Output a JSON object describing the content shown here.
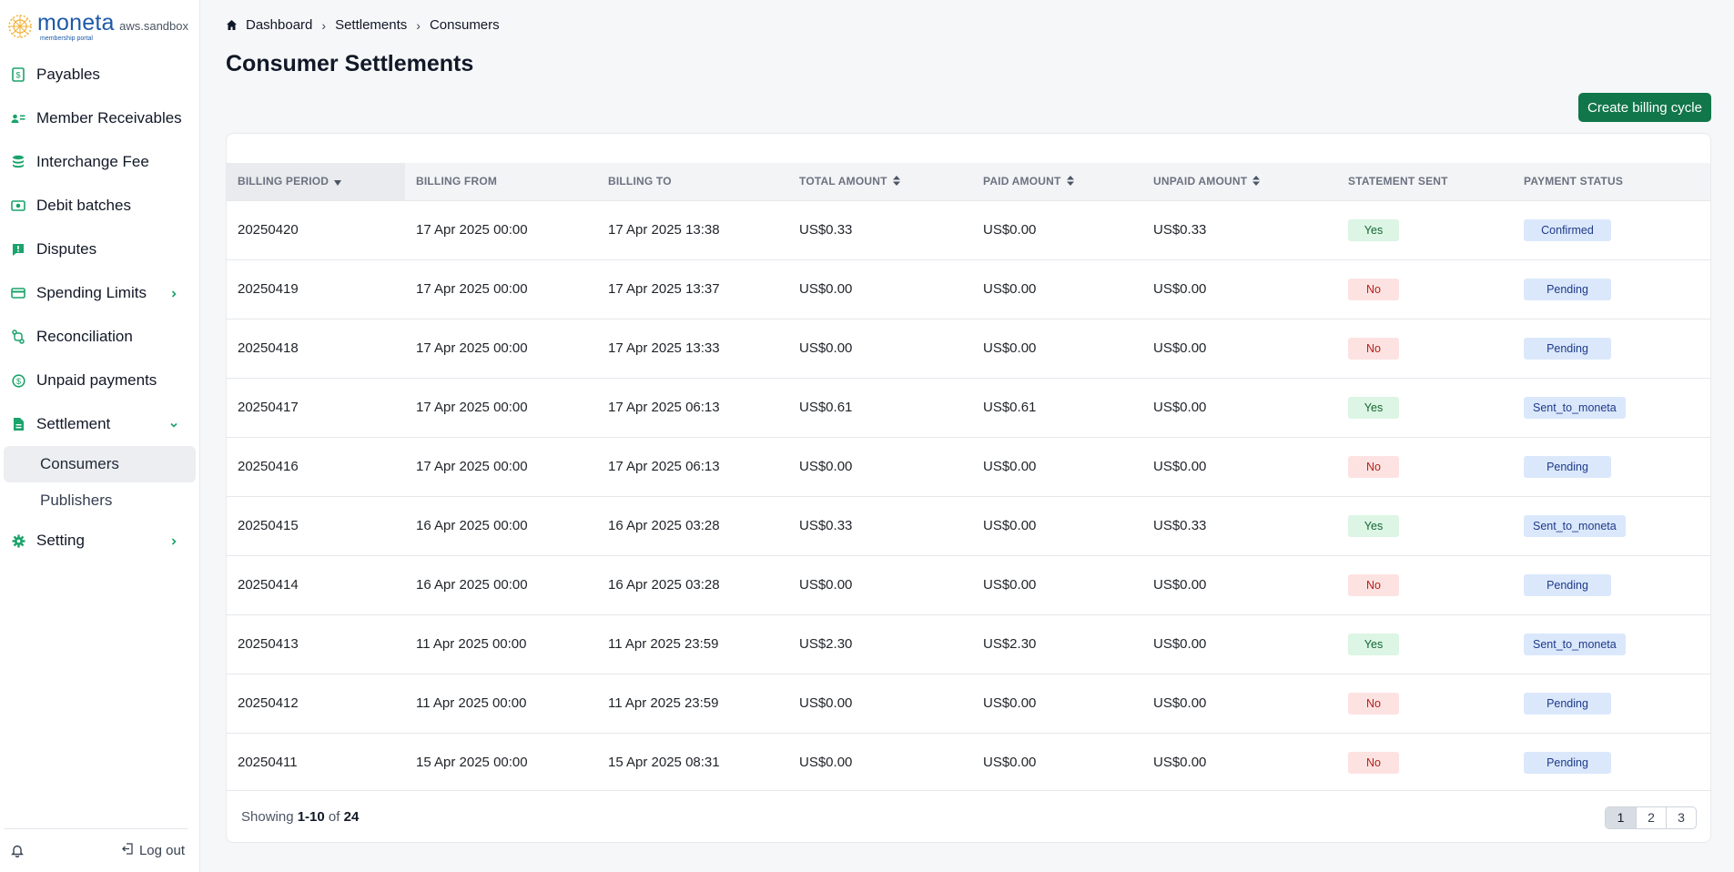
{
  "brand": {
    "name": "moneta",
    "subtitle": "membership portal",
    "env": "aws.sandbox"
  },
  "colors": {
    "accent": "#11764a",
    "icon": "#1aa36b",
    "brand": "#1e5aa8"
  },
  "sidebar": {
    "items": [
      {
        "label": "Payables",
        "icon": "invoice-icon"
      },
      {
        "label": "Member Receivables",
        "icon": "members-icon"
      },
      {
        "label": "Interchange Fee",
        "icon": "coins-icon"
      },
      {
        "label": "Debit batches",
        "icon": "cash-icon"
      },
      {
        "label": "Disputes",
        "icon": "alert-message-icon"
      },
      {
        "label": "Spending Limits",
        "icon": "credit-card-icon"
      },
      {
        "label": "Reconciliation",
        "icon": "arrows-icon"
      },
      {
        "label": "Unpaid payments",
        "icon": "dollar-circle-icon"
      },
      {
        "label": "Settlement",
        "icon": "document-icon"
      },
      {
        "label": "Setting",
        "icon": "gear-icon"
      }
    ],
    "settlement_sub": [
      {
        "label": "Consumers"
      },
      {
        "label": "Publishers"
      }
    ],
    "logout_label": "Log out"
  },
  "breadcrumb": [
    "Dashboard",
    "Settlements",
    "Consumers"
  ],
  "page_title": "Consumer Settlements",
  "create_button": "Create billing cycle",
  "table": {
    "headers": [
      "BILLING PERIOD",
      "BILLING FROM",
      "BILLING TO",
      "TOTAL AMOUNT",
      "PAID AMOUNT",
      "UNPAID AMOUNT",
      "STATEMENT SENT",
      "PAYMENT STATUS"
    ],
    "rows": [
      [
        "20250420",
        "17 Apr 2025 00:00",
        "17 Apr 2025 13:38",
        "US$0.33",
        "US$0.00",
        "US$0.33",
        "Yes",
        "Confirmed"
      ],
      [
        "20250419",
        "17 Apr 2025 00:00",
        "17 Apr 2025 13:37",
        "US$0.00",
        "US$0.00",
        "US$0.00",
        "No",
        "Pending"
      ],
      [
        "20250418",
        "17 Apr 2025 00:00",
        "17 Apr 2025 13:33",
        "US$0.00",
        "US$0.00",
        "US$0.00",
        "No",
        "Pending"
      ],
      [
        "20250417",
        "17 Apr 2025 00:00",
        "17 Apr 2025 06:13",
        "US$0.61",
        "US$0.61",
        "US$0.00",
        "Yes",
        "Sent_to_moneta"
      ],
      [
        "20250416",
        "17 Apr 2025 00:00",
        "17 Apr 2025 06:13",
        "US$0.00",
        "US$0.00",
        "US$0.00",
        "No",
        "Pending"
      ],
      [
        "20250415",
        "16 Apr 2025 00:00",
        "16 Apr 2025 03:28",
        "US$0.33",
        "US$0.00",
        "US$0.33",
        "Yes",
        "Sent_to_moneta"
      ],
      [
        "20250414",
        "16 Apr 2025 00:00",
        "16 Apr 2025 03:28",
        "US$0.00",
        "US$0.00",
        "US$0.00",
        "No",
        "Pending"
      ],
      [
        "20250413",
        "11 Apr 2025 00:00",
        "11 Apr 2025 23:59",
        "US$2.30",
        "US$2.30",
        "US$0.00",
        "Yes",
        "Sent_to_moneta"
      ],
      [
        "20250412",
        "11 Apr 2025 00:00",
        "11 Apr 2025 23:59",
        "US$0.00",
        "US$0.00",
        "US$0.00",
        "No",
        "Pending"
      ],
      [
        "20250411",
        "15 Apr 2025 00:00",
        "15 Apr 2025 08:31",
        "US$0.00",
        "US$0.00",
        "US$0.00",
        "No",
        "Pending"
      ]
    ]
  },
  "footer": {
    "showing_prefix": "Showing",
    "range": "1-10",
    "of": "of",
    "total": "24",
    "pages": [
      "1",
      "2",
      "3"
    ],
    "current_page": "1"
  }
}
